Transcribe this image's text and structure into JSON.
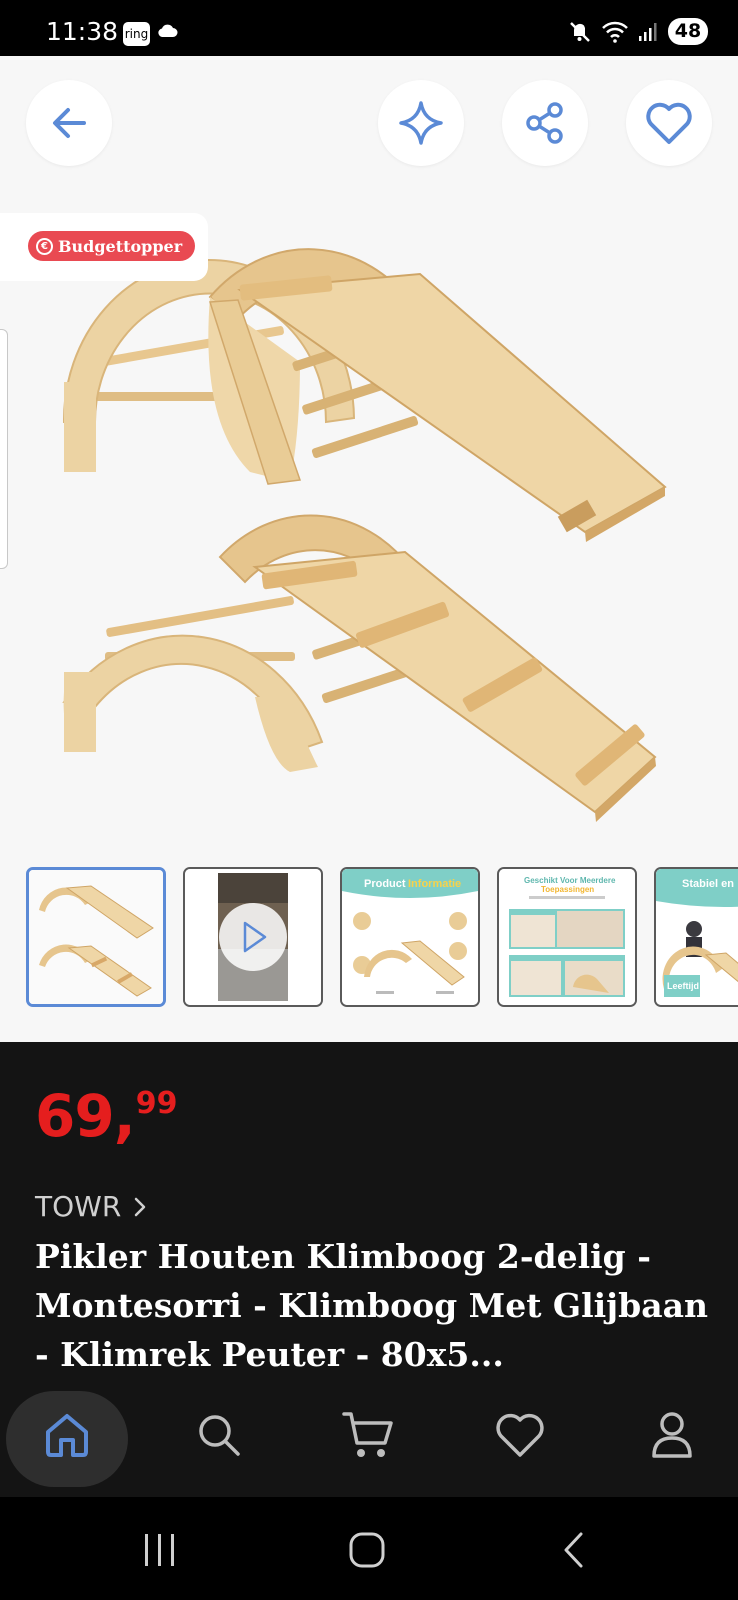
{
  "status_bar": {
    "time": "11:38",
    "ring_label": "ring",
    "battery": "48"
  },
  "product": {
    "badge": "Budgettopper",
    "price_int": "69,",
    "price_dec": "99",
    "brand": "TOWR",
    "title": "Pikler Houten Klimboog 2-delig - Montesorri - Klimboog Met Glijbaan - Klimrek Peuter - 80x5..."
  },
  "thumbnails": [
    {
      "kind": "photo",
      "active": true
    },
    {
      "kind": "video",
      "active": false
    },
    {
      "kind": "infographic",
      "heading_a": "Product",
      "heading_b": "Informatie",
      "active": false
    },
    {
      "kind": "infographic",
      "heading_a": "Geschikt Voor Meerdere",
      "heading_b": "Toepassingen",
      "active": false
    },
    {
      "kind": "infographic",
      "heading_a": "Stabiel en",
      "footer": "Leeftijd",
      "active": false
    }
  ],
  "bottom_nav": [
    "home-icon",
    "search-icon",
    "cart-icon",
    "heart-icon",
    "user-icon"
  ],
  "colors": {
    "accent_blue": "#5b8ad6",
    "price_red": "#e51e1e",
    "badge_red": "#e94a52",
    "wood_light": "#ecd3a3",
    "wood_mid": "#dfbd84",
    "wood_dark": "#c99d5e"
  }
}
